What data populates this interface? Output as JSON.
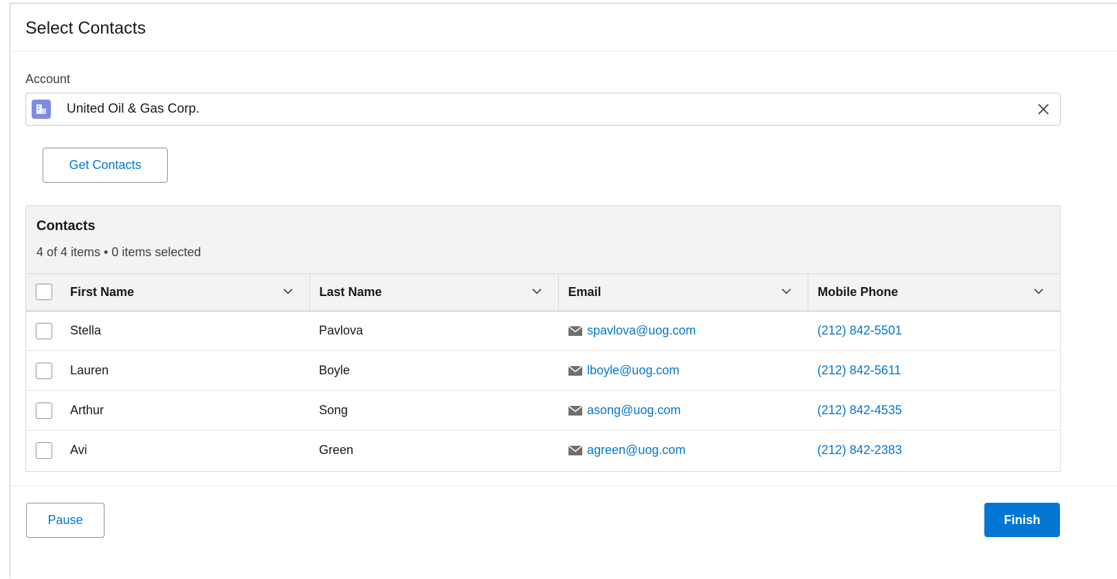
{
  "modal": {
    "title": "Select Contacts"
  },
  "account": {
    "label": "Account",
    "value": "United Oil & Gas Corp."
  },
  "actions": {
    "get_contacts": "Get Contacts",
    "pause": "Pause",
    "finish": "Finish"
  },
  "contacts": {
    "title": "Contacts",
    "summary": "4 of 4 items • 0 items selected",
    "columns": [
      "First Name",
      "Last Name",
      "Email",
      "Mobile Phone"
    ],
    "rows": [
      {
        "first": "Stella",
        "last": "Pavlova",
        "email": "spavlova@uog.com",
        "phone": "(212) 842-5501"
      },
      {
        "first": "Lauren",
        "last": "Boyle",
        "email": "lboyle@uog.com",
        "phone": "(212) 842-5611"
      },
      {
        "first": "Arthur",
        "last": "Song",
        "email": "asong@uog.com",
        "phone": "(212) 842-4535"
      },
      {
        "first": "Avi",
        "last": "Green",
        "email": "agreen@uog.com",
        "phone": "(212) 842-2383"
      }
    ]
  },
  "icons": {
    "account": "account-icon",
    "clear": "close-icon",
    "sort": "chevron-down-icon",
    "email": "envelope-icon"
  },
  "colors": {
    "brand": "#0176d3",
    "account_icon": "#7f8de1",
    "header_bg": "#f3f3f3"
  }
}
